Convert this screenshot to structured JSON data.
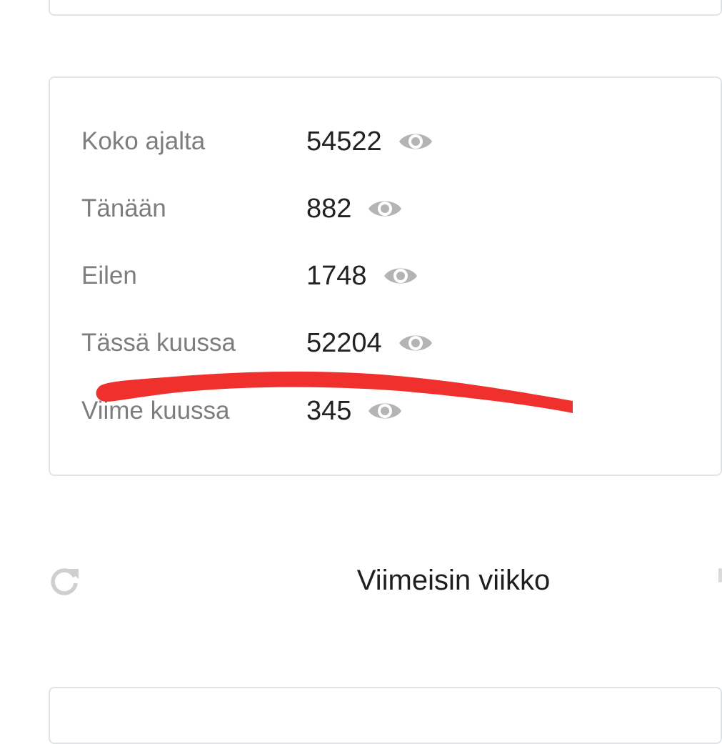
{
  "stats": {
    "rows": [
      {
        "label": "Koko ajalta",
        "value": "54522",
        "icon": "eye-icon"
      },
      {
        "label": "Tänään",
        "value": "882",
        "icon": "eye-icon"
      },
      {
        "label": "Eilen",
        "value": "1748",
        "icon": "eye-icon"
      },
      {
        "label": "Tässä kuussa",
        "value": "52204",
        "icon": "eye-icon"
      },
      {
        "label": "Viime kuussa",
        "value": "345",
        "icon": "eye-icon"
      }
    ]
  },
  "section": {
    "title": "Viimeisin viikko",
    "refresh_icon": "refresh-icon"
  },
  "colors": {
    "label": "#7d7d7d",
    "value": "#222222",
    "icon": "#b4b4b4",
    "border": "#e1e4e6",
    "annotation": "#f0302d"
  }
}
